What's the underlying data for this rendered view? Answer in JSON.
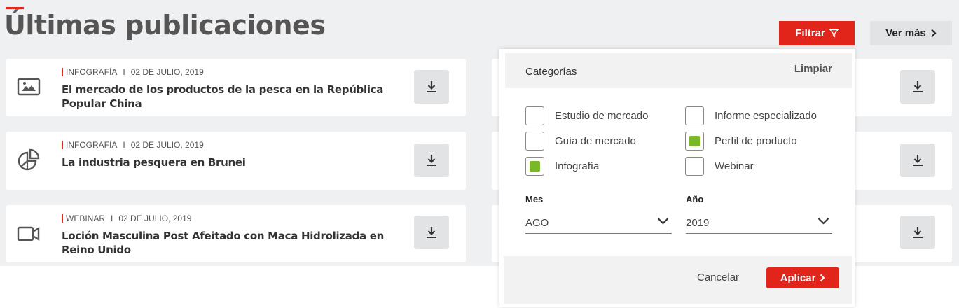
{
  "page": {
    "title": "Últimas publicaciones"
  },
  "header": {
    "filter_label": "Filtrar",
    "ver_mas_label": "Ver más"
  },
  "publications": [
    {
      "category": "INFOGRAFÍA",
      "date": "02 DE JULIO, 2019",
      "title": "El mercado de los productos de la pesca en la República Popular China",
      "icon": "image-icon"
    },
    {
      "category": "INFOGRAFÍA",
      "date": "02 DE JULIO, 2019",
      "title": "La industria pesquera en Brunei",
      "icon": "pie-chart-icon"
    },
    {
      "category": "WEBINAR",
      "date": "02 DE JULIO, 2019",
      "title": "Loción Masculina Post Afeitado con Maca Hidrolizada en Reino Unido",
      "icon": "video-camera-icon"
    }
  ],
  "filter_panel": {
    "categories_label": "Categorías",
    "clear_label": "Limpiar",
    "checkboxes": [
      {
        "label": "Estudio de mercado",
        "checked": false
      },
      {
        "label": "Informe especializado",
        "checked": false
      },
      {
        "label": "Guía de mercado",
        "checked": false
      },
      {
        "label": "Perfil de producto",
        "checked": true
      },
      {
        "label": "Infografía",
        "checked": true
      },
      {
        "label": "Webinar",
        "checked": false
      }
    ],
    "month_label": "Mes",
    "month_value": "AGO",
    "year_label": "Año",
    "year_value": "2019",
    "cancel_label": "Cancelar",
    "apply_label": "Aplicar"
  },
  "colors": {
    "accent": "#e1251b",
    "check": "#7ab829",
    "background": "#eff0f2"
  }
}
